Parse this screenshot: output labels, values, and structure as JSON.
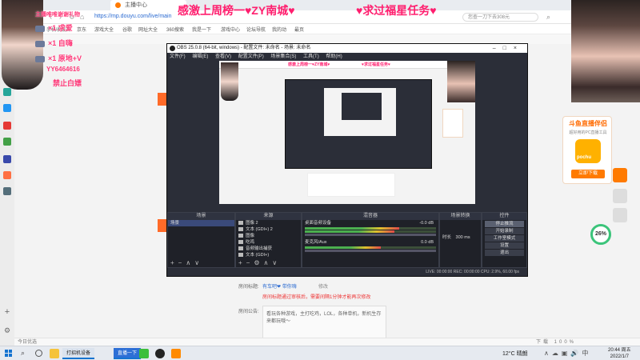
{
  "browser": {
    "tab_title": "主播中心",
    "url": "https://mp.douyu.com/live/main",
    "search_placeholder": "您查一刀下去308元",
    "bookmarks": [
      "手机收藏夹",
      "京东",
      "游戏大全",
      "谷歌",
      "网址大全",
      "360搜索",
      "我是一下",
      "游戏中心",
      "论坛导航",
      "我的动",
      "最页"
    ],
    "status_left": "今日优选",
    "status_right": "下载  100%"
  },
  "overlay": {
    "title": "感激上周榜一♥ZY南城♥",
    "task": "♥求过福星任务♥",
    "gifts": [
      {
        "label": "×1  求爱"
      },
      {
        "label": "×1  自嗨"
      },
      {
        "label": "×1  原地+V"
      }
    ],
    "gift_top": "主播唯唯谢谢礼物",
    "gift_code": "YY6464616",
    "gift_ban": "禁止白嫖"
  },
  "page": {
    "room_label": "房间标题:",
    "room_name": "有车吧❤ 带你嗨",
    "room_edit": "修改",
    "room_note": "房间标题通过审核后，需要间隔1分钟才能再次修改",
    "notice_label": "房间公告:",
    "notice_text": "看玩各种游戏，主打吃鸡，LOL，各种单机，新机生存来都玩哦～"
  },
  "ad": {
    "title": "斗鱼直播伴侣",
    "subtitle": "超好用的PC直播工具",
    "logo_text": "pochu",
    "button": "立即下载"
  },
  "progress": {
    "value": "26%"
  },
  "obs": {
    "title": "OBS 25.0.8 (64-bit, windows) - 配置文件: 未命名 - 场景: 未命名",
    "menu": [
      "文件(F)",
      "编辑(E)",
      "查看(V)",
      "配置文件(P)",
      "场景集合(S)",
      "工具(T)",
      "帮助(H)"
    ],
    "docks": {
      "scenes": {
        "title": "场景",
        "items": [
          "场景"
        ]
      },
      "sources": {
        "title": "来源",
        "items": [
          "图像 2",
          "文本 (GDI+) 2",
          "图像",
          "吃鸡",
          "音频输出捕获",
          "文本 (GDI+)"
        ]
      },
      "mixer": {
        "title": "混音器",
        "channels": [
          {
            "name": "桌面音频设备",
            "db": "-0.0 dB",
            "level": 0.72
          },
          {
            "name": "麦克风/Aux",
            "db": "0.0 dB",
            "level": 0.58
          }
        ]
      },
      "transitions": {
        "title": "场景转换",
        "duration_label": "时长",
        "duration": "300 ms"
      },
      "controls": {
        "title": "控件",
        "buttons": [
          "停止推流",
          "开始录制",
          "工作室模式",
          "设置",
          "退出"
        ]
      }
    },
    "status": "LIVE: 00:00:00   REC: 00:00:00   CPU: 2.9%, 60.00 fps"
  },
  "taskbar": {
    "apps": [
      "打招机设备",
      "直播一下"
    ],
    "weather": "12°C 晴朗",
    "time": "20:44 周五",
    "date": "2022/1/7"
  }
}
